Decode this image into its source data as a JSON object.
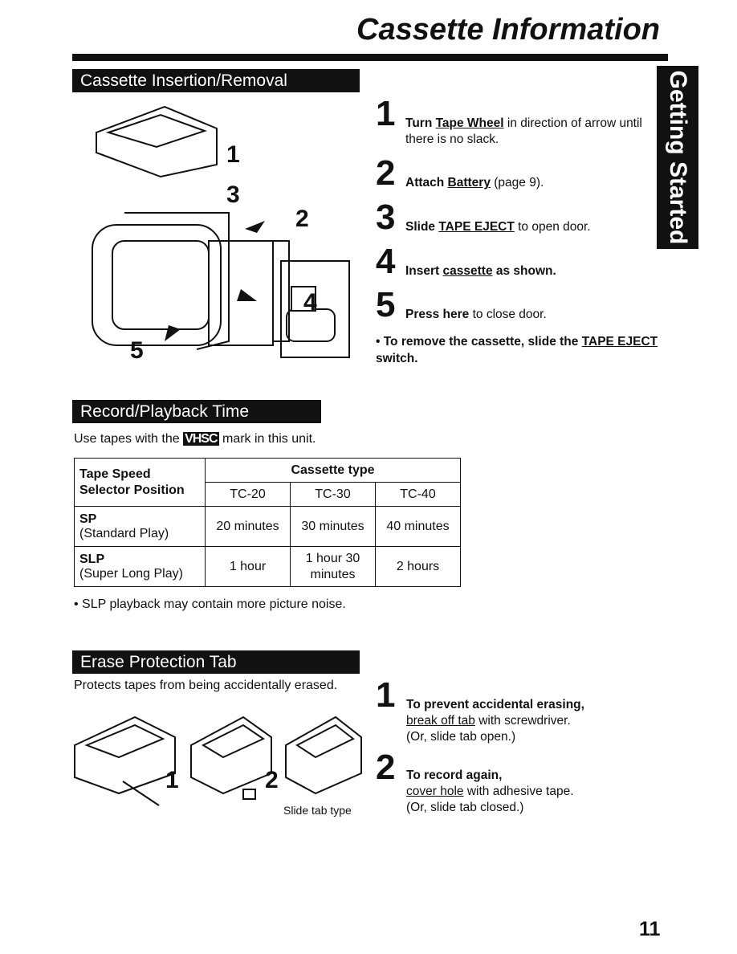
{
  "title": "Cassette Information",
  "side_tab": "Getting Started",
  "insertion": {
    "heading": "Cassette Insertion/Removal",
    "figure_labels": [
      "1",
      "3",
      "2",
      "4",
      "5"
    ],
    "steps": [
      {
        "n": "1",
        "pre": "Turn ",
        "link": "Tape Wheel",
        "post": " in direction of arrow until there is no slack."
      },
      {
        "n": "2",
        "pre": "Attach ",
        "link": "Battery",
        "post": " (page 9)."
      },
      {
        "n": "3",
        "pre": "Slide ",
        "link": "TAPE EJECT",
        "post": " to open door."
      },
      {
        "n": "4",
        "pre": "Insert ",
        "link": "cassette",
        "post": " as shown."
      },
      {
        "n": "5",
        "pre": "Press here",
        "link": "",
        "post": " to close door."
      }
    ],
    "remove_note_pre": "• To remove the cassette, slide the ",
    "remove_note_link": "TAPE EJECT",
    "remove_note_post": " switch."
  },
  "record": {
    "heading": "Record/Playback Time",
    "intro_pre": "Use tapes with the",
    "intro_logo": "VHSC",
    "intro_post": "mark in this unit.",
    "table": {
      "row_header": "Tape Speed Selector Position",
      "group_header": "Cassette type",
      "columns": [
        "TC-20",
        "TC-30",
        "TC-40"
      ],
      "rows": [
        {
          "mode": "SP",
          "desc": "(Standard Play)",
          "values": [
            "20 minutes",
            "30 minutes",
            "40 minutes"
          ]
        },
        {
          "mode": "SLP",
          "desc": "(Super Long Play)",
          "values": [
            "1 hour",
            "1 hour 30 minutes",
            "2 hours"
          ]
        }
      ]
    },
    "note": "• SLP playback may contain more picture noise."
  },
  "erase": {
    "heading": "Erase Protection Tab",
    "intro": "Protects tapes from being accidentally erased.",
    "figure_labels": [
      "1",
      "2"
    ],
    "slide_caption": "Slide tab type",
    "steps": [
      {
        "n": "1",
        "bold": "To prevent accidental erasing,",
        "link": "break off tab",
        "post": " with screwdriver.",
        "paren": "(Or, slide tab open.)"
      },
      {
        "n": "2",
        "bold": "To record again,",
        "link": "cover hole",
        "post": " with adhesive tape.",
        "paren": "(Or, slide tab closed.)"
      }
    ]
  },
  "page_number": "11"
}
